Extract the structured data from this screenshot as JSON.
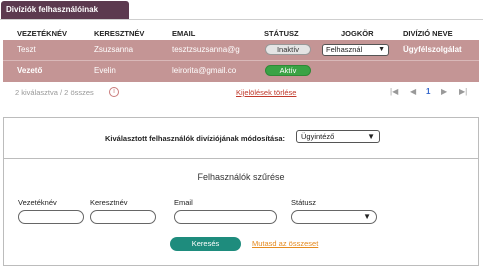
{
  "tab": {
    "title": "Divíziók felhasználóinak kezelése"
  },
  "table": {
    "headers": [
      "VEZETÉKNÉV",
      "KERESZTNÉV",
      "EMAIL",
      "STÁTUSZ",
      "JOGKÖR",
      "DIVÍZIÓ NEVE"
    ],
    "rows": [
      {
        "last": "Teszt",
        "first": "Zsuzsanna",
        "email": "tesztzsuzsanna@g",
        "status": "Inaktív",
        "role": "Felhasznál",
        "division": "Ügyfélszolgálat"
      },
      {
        "last": "Vezető",
        "first": "Evelin",
        "email": "leirorita@gmail.co",
        "status": "Aktív",
        "role": "",
        "division": ""
      }
    ]
  },
  "pager": {
    "selection_count": "2 kiválasztva / 2 összes",
    "clear_label": "Kijelölések törlése",
    "first": "|◀",
    "prev": "◀",
    "current_page": "1",
    "next": "▶",
    "last": "▶|"
  },
  "division_change": {
    "label": "Kiválasztott felhasználók divíziójának módosítása:",
    "selected": "Ügyintéző"
  },
  "filter": {
    "title": "Felhasználók szűrése",
    "last_name_label": "Vezetéknév",
    "first_name_label": "Keresztnév",
    "email_label": "Email",
    "status_label": "Státusz",
    "search_label": "Keresés",
    "show_all_label": "Mutasd az összeset"
  },
  "colors": {
    "tab_bg": "#5c3a4f",
    "row_bg": "#c49595",
    "active": "#3aa345",
    "search_btn": "#1e8c7d",
    "show_all_link": "#e58a1f",
    "clear_link": "#c0392b"
  }
}
